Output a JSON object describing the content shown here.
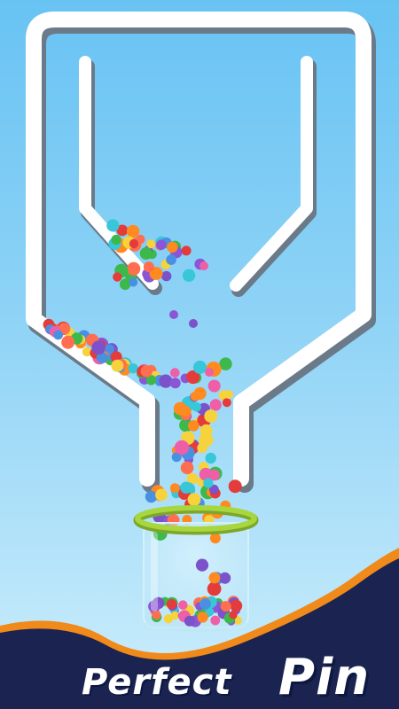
{
  "title": {
    "word1": "Perfect",
    "word2": "Pin"
  },
  "colors": {
    "background_top": "#68c3f3",
    "pipe": "#ffffff",
    "pipe_shadow": "#7a8a99",
    "banner_navy": "#1b2451",
    "banner_orange": "#f08a1a",
    "cup_rim": "#9ccd3a"
  },
  "ball_palette": [
    "#e43b3b",
    "#ff8a1f",
    "#3db84a",
    "#4a90e2",
    "#8a56d6",
    "#ee5fa7",
    "#38c6d9",
    "#f6d23c",
    "#7b52c9",
    "#ff6f4f"
  ]
}
